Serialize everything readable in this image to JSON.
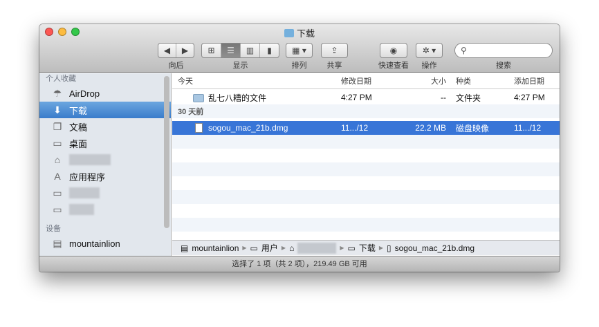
{
  "window": {
    "title": "下载"
  },
  "toolbar": {
    "back_label": "向后",
    "view_label": "显示",
    "arrange_label": "排列",
    "share_label": "共享",
    "quicklook_label": "快速查看",
    "action_label": "操作",
    "search_label": "搜索",
    "search_placeholder": ""
  },
  "sidebar": {
    "favorites_header": "个人收藏",
    "items": [
      {
        "label": "AirDrop",
        "icon": "airdrop-icon"
      },
      {
        "label": "下载",
        "icon": "downloads-icon"
      },
      {
        "label": "文稿",
        "icon": "documents-icon"
      },
      {
        "label": "桌面",
        "icon": "desktop-icon"
      },
      {
        "label": "",
        "icon": "home-icon"
      },
      {
        "label": "应用程序",
        "icon": "applications-icon"
      },
      {
        "label": "",
        "icon": "folder-icon"
      },
      {
        "label": "",
        "icon": "folder-icon"
      }
    ],
    "devices_header": "设备",
    "devices": [
      {
        "label": "mountainlion",
        "icon": "disk-icon"
      }
    ]
  },
  "columns": {
    "name": "今天",
    "modified": "修改日期",
    "size": "大小",
    "kind": "种类",
    "added": "添加日期"
  },
  "groups": [
    {
      "label": "今天",
      "files": [
        {
          "name": "乱七八糟的文件",
          "modified": "4:27 PM",
          "size": "--",
          "kind": "文件夹",
          "added": "4:27 PM"
        }
      ]
    },
    {
      "label": "30 天前",
      "files": [
        {
          "name": "sogou_mac_21b.dmg",
          "modified": "11.../12",
          "size": "22.2 MB",
          "kind": "磁盘映像",
          "added": "11.../12"
        }
      ]
    }
  ],
  "pathbar": [
    "mountainlion",
    "用户",
    "",
    "下载",
    "sogou_mac_21b.dmg"
  ],
  "status": "选择了 1 项（共 2 项），219.49 GB 可用"
}
